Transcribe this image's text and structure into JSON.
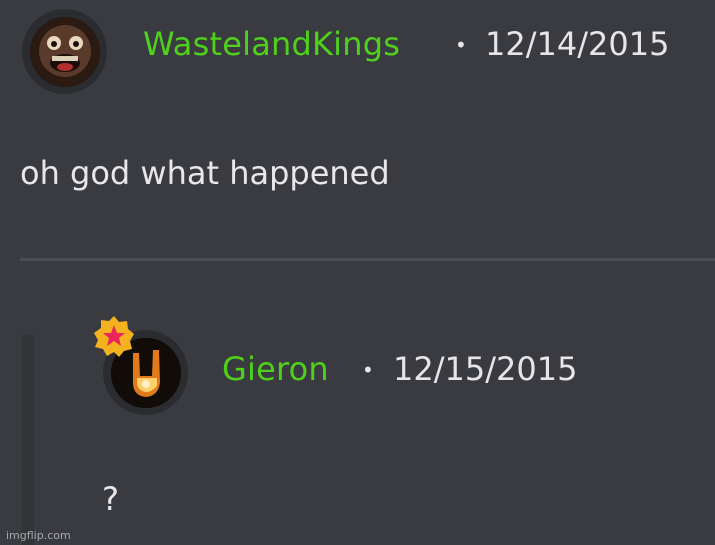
{
  "comment": {
    "author": "WastelandKings",
    "date": "12/14/2015",
    "separator": "•",
    "text": "oh god what happened",
    "author_color": "#4fd11c"
  },
  "reply": {
    "author": "Gieron",
    "date": "12/15/2015",
    "separator": "•",
    "text": "?",
    "author_color": "#4fd11c"
  },
  "watermark": "imgflip.com"
}
